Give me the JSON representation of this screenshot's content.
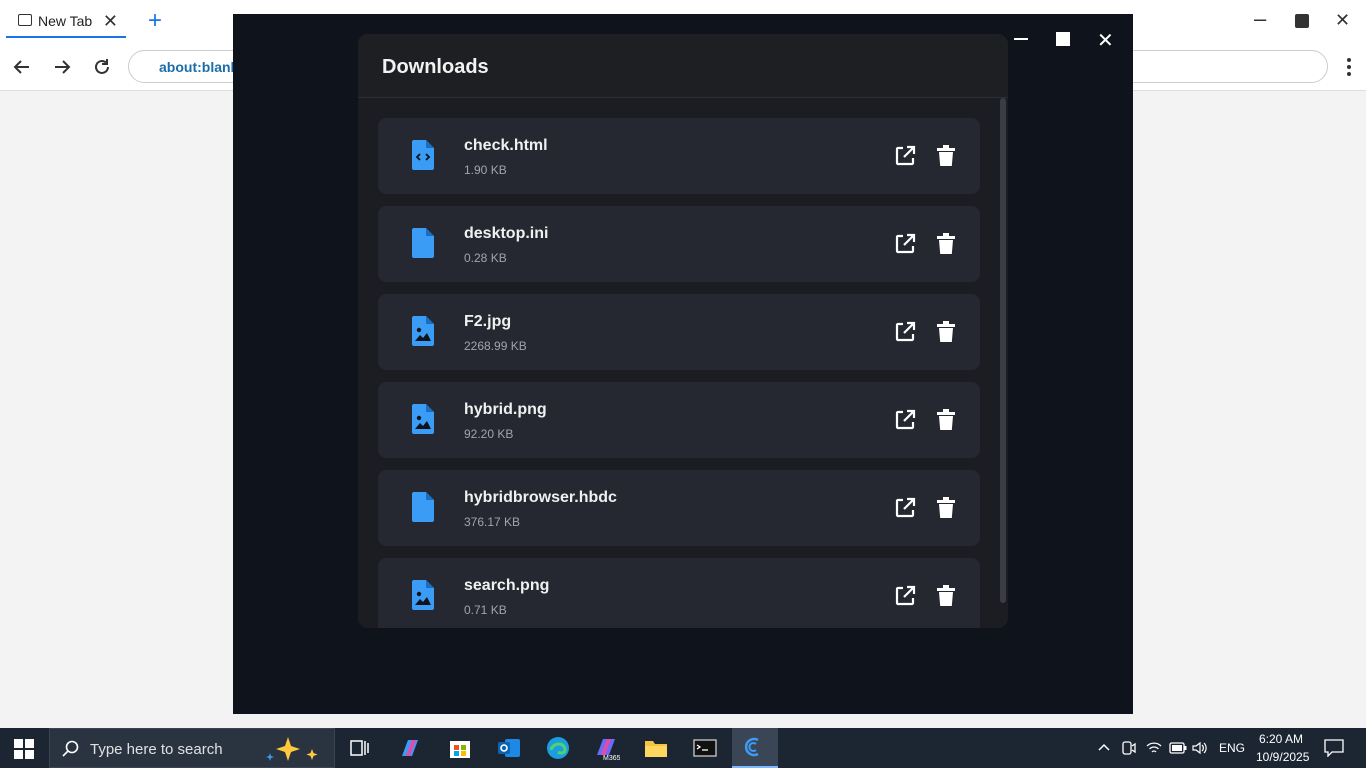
{
  "browser": {
    "tab_title": "New Tab",
    "address": "about:blank"
  },
  "downloads": {
    "title": "Downloads",
    "items": [
      {
        "name": "check.html",
        "size": "1.90 KB",
        "icon": "code-file-icon"
      },
      {
        "name": "desktop.ini",
        "size": "0.28 KB",
        "icon": "file-icon"
      },
      {
        "name": "F2.jpg",
        "size": "2268.99 KB",
        "icon": "image-file-icon"
      },
      {
        "name": "hybrid.png",
        "size": "92.20 KB",
        "icon": "image-file-icon"
      },
      {
        "name": "hybridbrowser.hbdc",
        "size": "376.17 KB",
        "icon": "file-icon"
      },
      {
        "name": "search.png",
        "size": "0.71 KB",
        "icon": "image-file-icon"
      }
    ]
  },
  "taskbar": {
    "search_placeholder": "Type here to search",
    "language": "ENG",
    "time": "6:20 AM",
    "date": "10/9/2025"
  },
  "colors": {
    "accent": "#1a73e8",
    "file_icon": "#3b9cf5",
    "panel_bg": "#1b1d22",
    "item_bg": "#252830",
    "overlay_bg": "#0f131b"
  }
}
